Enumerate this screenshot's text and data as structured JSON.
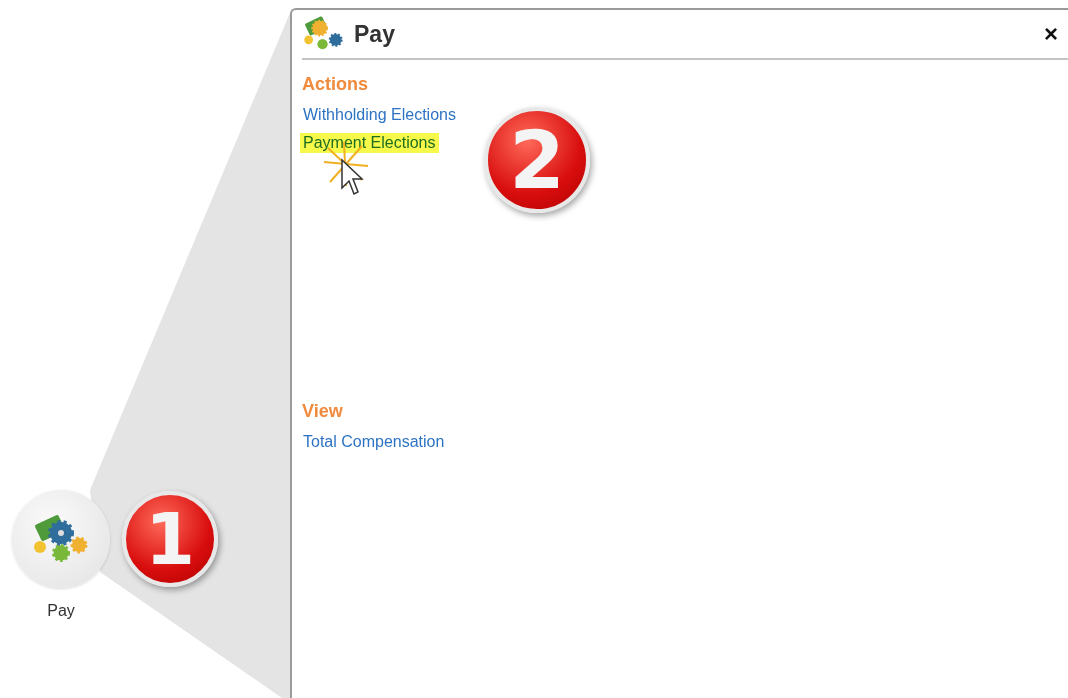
{
  "app_tile": {
    "label": "Pay"
  },
  "steps": [
    {
      "number": "1"
    },
    {
      "number": "2"
    }
  ],
  "panel": {
    "title": "Pay",
    "close": "×",
    "sections": [
      {
        "heading": "Actions",
        "links": [
          {
            "label": "Withholding Elections",
            "highlighted": false
          },
          {
            "label": "Payment Elections",
            "highlighted": true
          }
        ]
      },
      {
        "heading": "View",
        "links": [
          {
            "label": "Total Compensation",
            "highlighted": false
          }
        ]
      }
    ]
  }
}
